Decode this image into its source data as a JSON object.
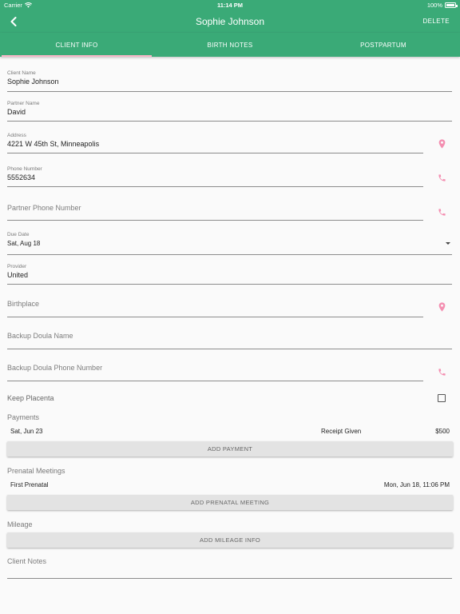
{
  "status_bar": {
    "carrier": "Carrier",
    "time": "11:14 PM",
    "battery": "100%"
  },
  "app_bar": {
    "title": "Sophie Johnson",
    "delete_label": "DELETE"
  },
  "tabs": [
    {
      "label": "CLIENT INFO",
      "active": true
    },
    {
      "label": "BIRTH NOTES",
      "active": false
    },
    {
      "label": "POSTPARTUM",
      "active": false
    }
  ],
  "form": {
    "client_name": {
      "label": "Client Name",
      "value": "Sophie Johnson"
    },
    "partner_name": {
      "label": "Partner Name",
      "value": "David"
    },
    "address": {
      "label": "Address",
      "value": "4221 W 45th St, Minneapolis"
    },
    "phone_number": {
      "label": "Phone Number",
      "value": "5552634"
    },
    "partner_phone": {
      "placeholder": "Partner Phone Number"
    },
    "due_date": {
      "label": "Due Date",
      "value": "Sat, Aug 18"
    },
    "provider": {
      "label": "Provider",
      "value": "United"
    },
    "birthplace": {
      "placeholder": "Birthplace"
    },
    "backup_doula_name": {
      "placeholder": "Backup Doula Name"
    },
    "backup_doula_phone": {
      "placeholder": "Backup Doula Phone Number"
    },
    "keep_placenta": {
      "label": "Keep Placenta",
      "checked": false
    }
  },
  "payments": {
    "title": "Payments",
    "items": [
      {
        "date": "Sat, Jun 23",
        "status": "Receipt Given",
        "amount": "$500"
      }
    ],
    "add_label": "ADD PAYMENT"
  },
  "prenatal_meetings": {
    "title": "Prenatal Meetings",
    "items": [
      {
        "name": "First Prenatal",
        "datetime": "Mon, Jun 18, 11:06 PM"
      }
    ],
    "add_label": "ADD PRENATAL MEETING"
  },
  "mileage": {
    "title": "Mileage",
    "add_label": "ADD MILEAGE INFO"
  },
  "client_notes": {
    "placeholder": "Client Notes"
  },
  "colors": {
    "primary": "#3aaa77",
    "accent": "#f48fb1",
    "tab_indicator": "#f7b7c8"
  },
  "icons": {
    "back": "chevron-left-icon",
    "location": "map-pin-icon",
    "phone": "phone-icon",
    "dropdown": "caret-down-icon"
  }
}
